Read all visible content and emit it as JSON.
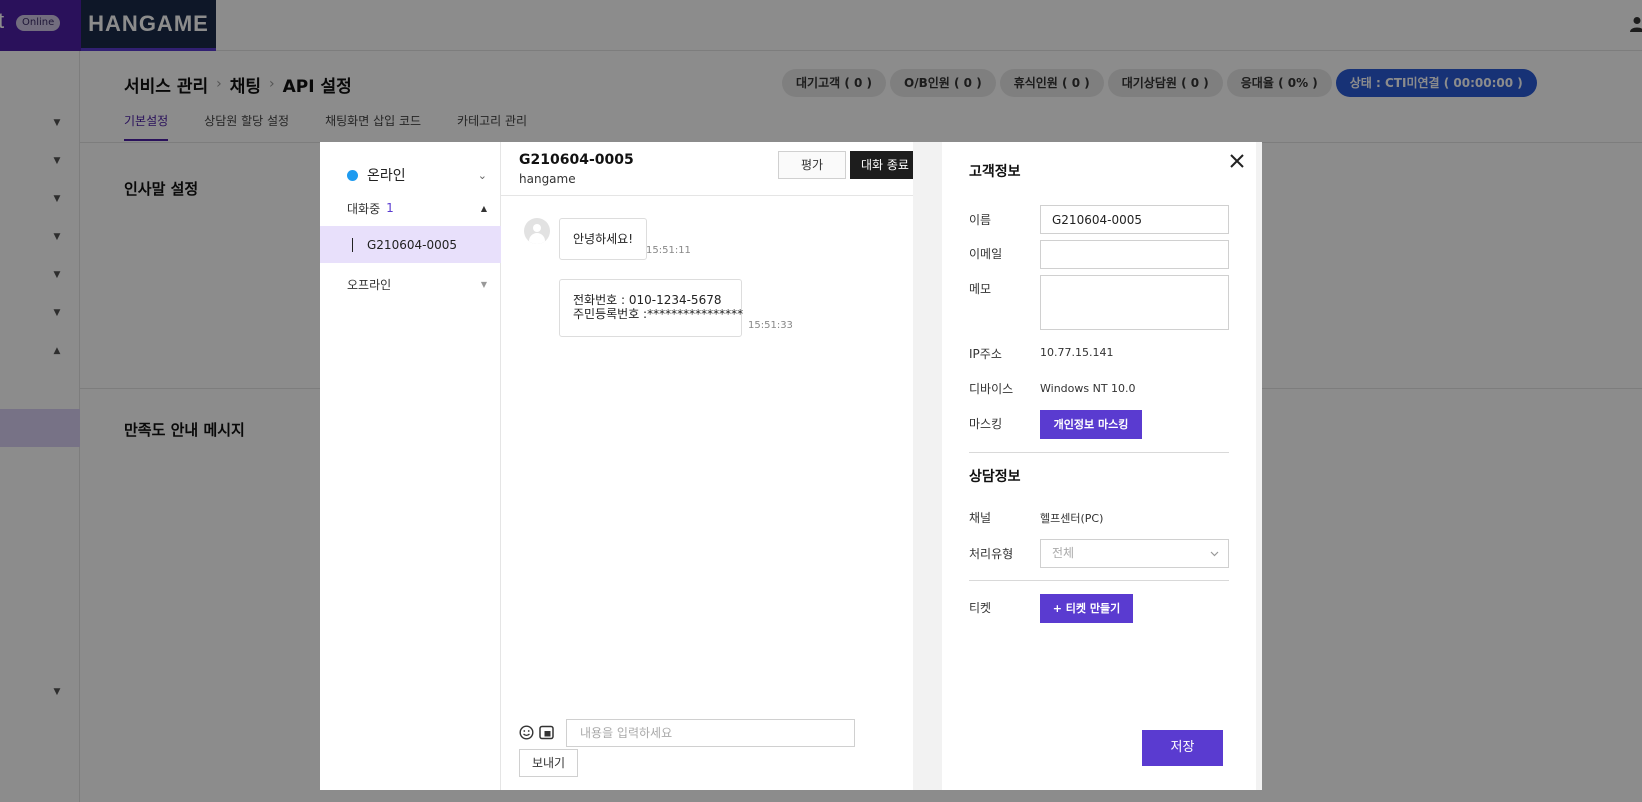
{
  "app": {
    "brand_online": "Online",
    "logo_text": "HANGAME"
  },
  "breadcrumb": [
    "서비스 관리",
    "채팅",
    "API 설정"
  ],
  "status_chips": [
    "대기고객 ( 0 )",
    "O/B인원 ( 0 )",
    "휴식인원 ( 0 )",
    "대기상담원 ( 0 )",
    "응대율 ( 0% )",
    "상태 : CTI미연결 ( 00:00:00 )"
  ],
  "tabs": [
    "기본설정",
    "상담원 할당 설정",
    "채팅화면 삽입 코드",
    "카테고리 관리"
  ],
  "sections": [
    "인사말 설정",
    "만족도 안내 메시지"
  ],
  "modal": {
    "left": {
      "status": "온라인",
      "active_group": "대화중",
      "active_count": "1",
      "conversation_id": "G210604-0005",
      "offline_group": "오프라인"
    },
    "chat": {
      "title": "G210604-0005",
      "subtitle": "hangame",
      "eval_button": "평가",
      "end_button": "대화 종료",
      "messages": [
        {
          "text": "안녕하세요!",
          "time": "15:51:11"
        },
        {
          "line1": "전화번호 : 010-1234-5678",
          "line2": "주민등록번호 :****************",
          "time": "15:51:33"
        }
      ],
      "input_placeholder": "내용을 입력하세요",
      "send_button": "보내기"
    },
    "customer": {
      "title": "고객정보",
      "name_label": "이름",
      "name_value": "G210604-0005",
      "email_label": "이메일",
      "email_value": "",
      "memo_label": "메모",
      "memo_value": "",
      "ip_label": "IP주소",
      "ip_value": "10.77.15.141",
      "device_label": "디바이스",
      "device_value": "Windows NT 10.0",
      "masking_label": "마스킹",
      "masking_button": "개인정보 마스킹"
    },
    "consult": {
      "title": "상담정보",
      "channel_label": "채널",
      "channel_value": "헬프센터(PC)",
      "type_label": "처리유형",
      "type_value": "전체",
      "ticket_label": "티켓",
      "ticket_button": "+ 티켓 만들기",
      "save_button": "저장"
    }
  }
}
